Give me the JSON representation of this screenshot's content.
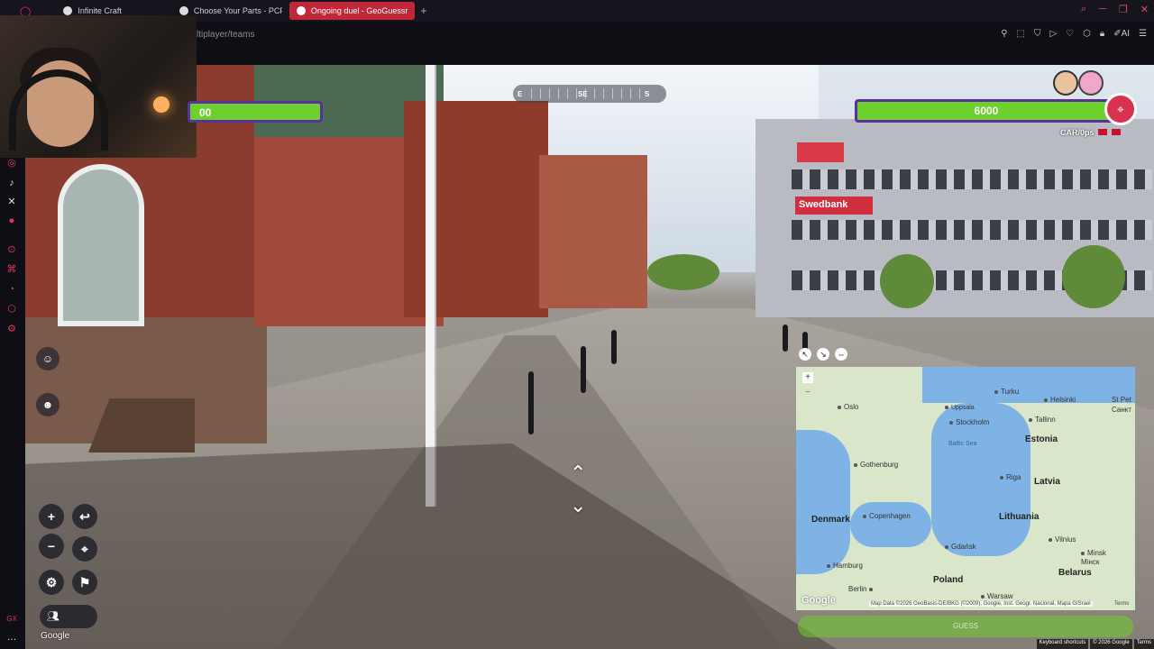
{
  "tabs": [
    {
      "label": "Infinite Craft",
      "active": false
    },
    {
      "label": "Choose Your Parts - PCPa",
      "active": false
    },
    {
      "label": "Ongoing duel - GeoGuessr",
      "active": true
    }
  ],
  "address": {
    "url_visible": "ltiplayer/teams"
  },
  "compass": {
    "left": "E",
    "center": "SE",
    "right": "S"
  },
  "health": {
    "left_value": "00",
    "right_value": "6000",
    "team_name": "CAR/0ps"
  },
  "map": {
    "countries": [
      "Estonia",
      "Latvia",
      "Lithuania",
      "Denmark",
      "Poland",
      "Belarus"
    ],
    "cities": [
      "Oslo",
      "Uppsala",
      "Stockholm",
      "Turku",
      "Helsinki",
      "Tallinn",
      "St Pet",
      "Санкт",
      "Gothenburg",
      "Riga",
      "Copenhagen",
      "Gdańsk",
      "Vilnius",
      "Minsk",
      "Мінск",
      "Hamburg",
      "Berlin",
      "Warsaw"
    ],
    "sea": "Baltic Sea",
    "attribution": "Map Data ©2026 GeoBasis-DE/BKG (©2009), Google, Inst. Geogr. Nacional, Mapa GISrael",
    "terms": "Terms",
    "google": "Google",
    "guess_label": "GUESS"
  },
  "scene": {
    "swedbank_sign": "Swedbank",
    "google_logo": "Google"
  },
  "footer": {
    "shortcuts": "Keyboard shortcuts",
    "copyright": "© 2026 Google",
    "terms": "Terms"
  },
  "colors": {
    "accent": "#c0283a",
    "health_green": "#6ed02c",
    "health_border": "#5b2fa0"
  }
}
